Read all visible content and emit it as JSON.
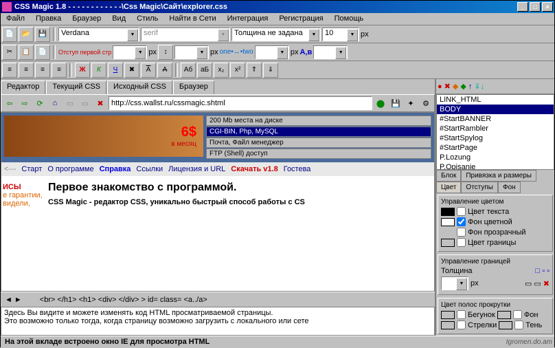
{
  "title": "CSS Magic 1.8 - - - - - - - - - - - -\\Css Magic\\Сайт\\explorer.css",
  "menu": [
    "Файл",
    "Правка",
    "Браузер",
    "Вид",
    "Стиль",
    "Найти в Сети",
    "Интеграция",
    "Регистрация",
    "Помощь"
  ],
  "font_family": "Verdana",
  "font_generic": "serif",
  "thickness": "Толщина не задана",
  "size_value": "10",
  "px_label": "px",
  "width_label": "Отступ первой стр",
  "tabs": [
    "Редактор",
    "Текущий CSS",
    "Исходный CSS",
    "Браузер"
  ],
  "url": "http://css.wallst.ru/cssmagic.shtml",
  "banner_price": "6$",
  "banner_sub": "в месяц",
  "banner_items": [
    "200 Mb места на диске",
    "CGI-BIN, Php, MySQL",
    "Почта, Файл менеджер",
    "FTP (Shell) доступ"
  ],
  "nav_links": [
    "<---",
    "Старт",
    "О программе",
    "Справка",
    "Ссылки",
    "Лицензия и URL",
    "Скачать v1.8",
    "Гостева"
  ],
  "side_frag": [
    "ИСЫ",
    "е гарантии,",
    "видели,"
  ],
  "page_h2": "Первое знакомство с программой.",
  "page_p": "CSS Magic - редактор CSS, уникально быстрый способ работы с CS",
  "html_tags": [
    "<br>",
    "</h1>",
    "<h1>",
    "<div>",
    "</div>",
    ">",
    "id=",
    "class=",
    "<a../a>"
  ],
  "html_text1": "Здесь Вы видите и можете изменять код HTML просматриваемой страницы.",
  "html_text2": "Это возможно только тогда, когда страницу возможно загрузить с локального или сете",
  "outline": [
    "LINK_HTML",
    "BODY",
    "#StartBANNER",
    "#StartRambler",
    "#StartSpylog",
    "#StartPage",
    "P.Lozung",
    "P.Opisanie"
  ],
  "prop_tabs_row1": [
    "Блок",
    "Привязка и размеры"
  ],
  "prop_tabs_row2": [
    "Цвет",
    "Отступы",
    "Фон"
  ],
  "color_group": "Управление цветом",
  "color_opts": [
    "Цвет текста",
    "Фон цветной",
    "Фон прозрачный",
    "Цвет границы"
  ],
  "border_group": "Управление границей",
  "border_thick": "Толщина",
  "scroll_group": "Цвет полос прокрутки",
  "scroll_labels": [
    "Бегунок",
    "Фон",
    "Стрелки",
    "Тень"
  ],
  "status": "На этой вкладе встроено окно IE для просмотра HTML",
  "watermark": "Igromen.do.am",
  "chart_data": null
}
